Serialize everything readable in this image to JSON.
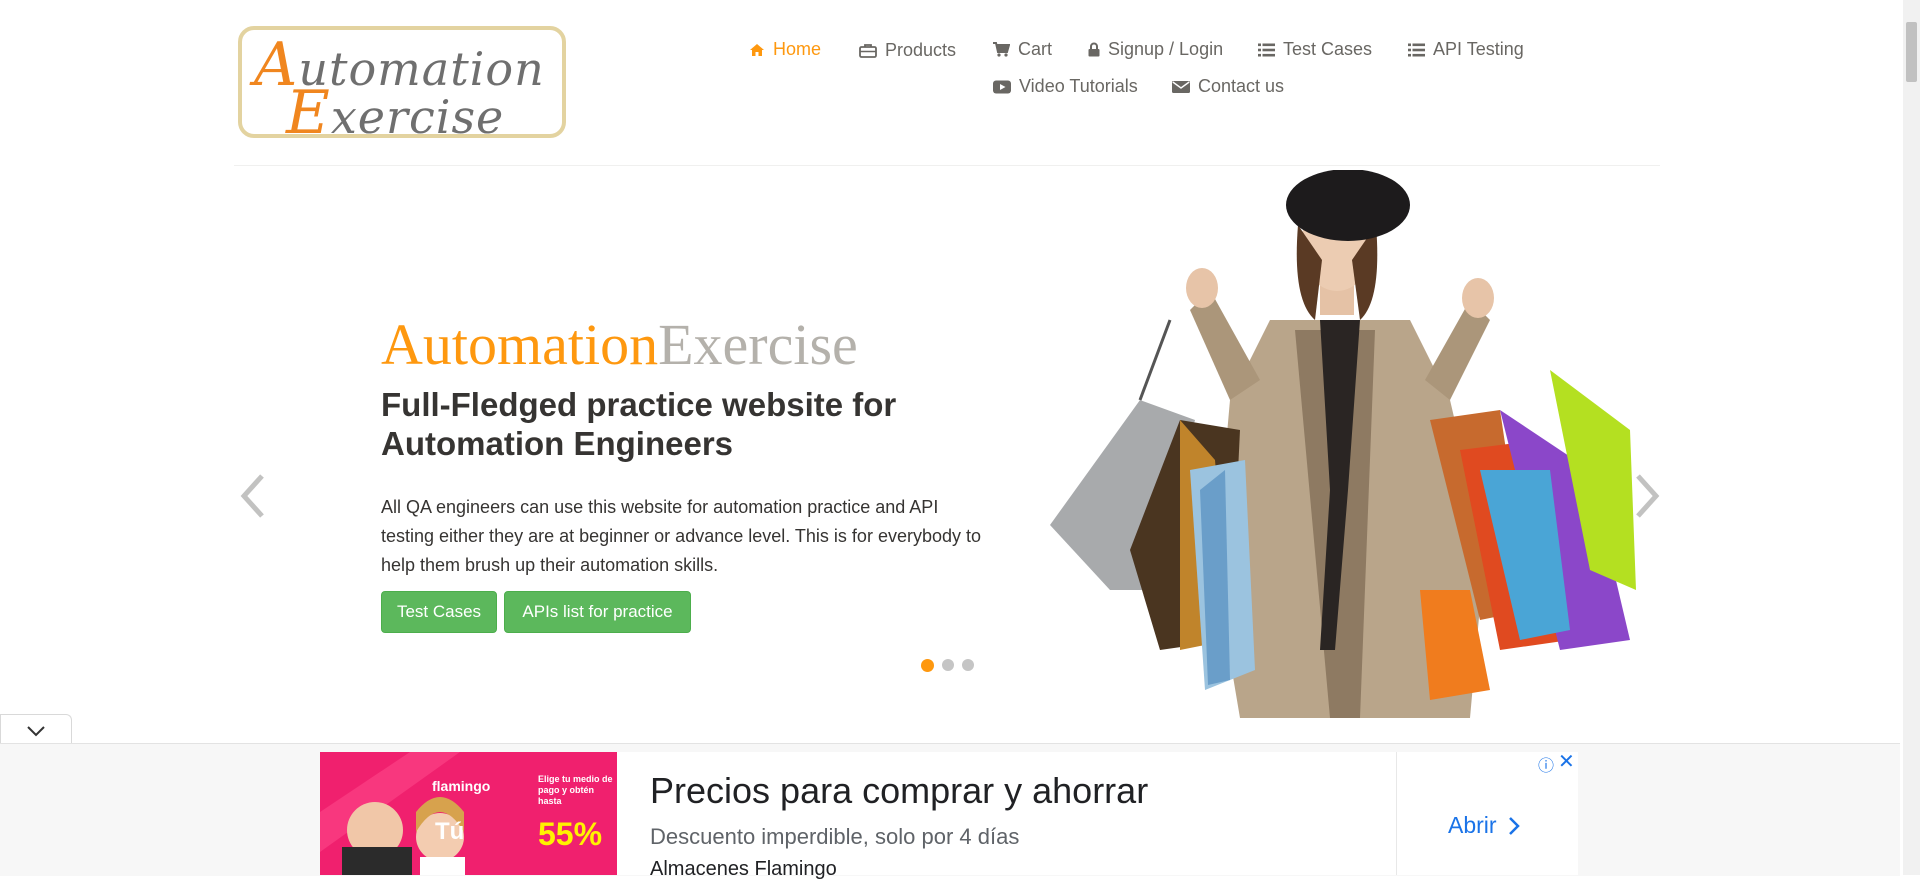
{
  "logo": {
    "line1_cap": "A",
    "line1_rest": "utomation",
    "line2_cap": "E",
    "line2_rest": "xercise"
  },
  "nav": {
    "home": "Home",
    "products": "Products",
    "cart": "Cart",
    "signup_login": "Signup / Login",
    "test_cases": "Test Cases",
    "api_testing": "API Testing",
    "video_tutorials": "Video Tutorials",
    "contact_us": "Contact us"
  },
  "hero": {
    "brand_part1": "Automation",
    "brand_part2": "Exercise",
    "heading": "Full-Fledged practice website for Automation Engineers",
    "text": "All QA engineers can use this website for automation practice and API testing either they are at beginner or advance level. This is for everybody to help them brush up their automation skills.",
    "btn_test_cases": "Test Cases",
    "btn_apis": "APIs list for practice",
    "active_slide": 1,
    "slide_count": 3
  },
  "ad": {
    "banner_brand": "flamingo",
    "banner_headline": "Elige tu medio de pago y obtén hasta",
    "banner_big": "55%",
    "banner_tu": "Tú",
    "title": "Precios para comprar y ahorrar",
    "description": "Descuento imperdible, solo por 4 días",
    "advertiser": "Almacenes Flamingo",
    "open_label": "Abrir"
  },
  "colors": {
    "accent": "#fe980f",
    "button": "#5cb85c",
    "ad_link": "#1a73e8"
  }
}
